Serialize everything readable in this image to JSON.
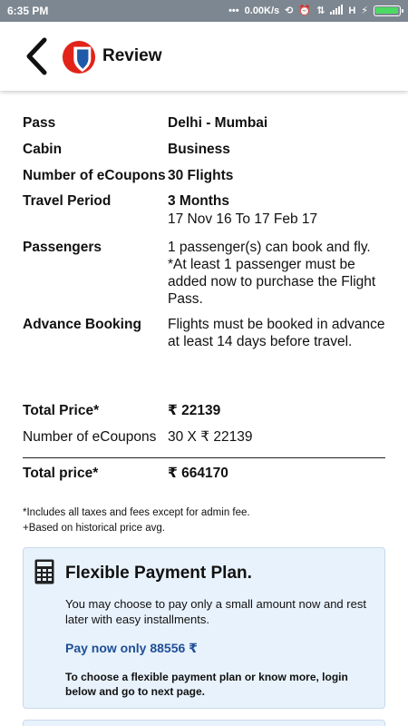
{
  "status_bar": {
    "time": "6:35 PM",
    "speed": "0.00K/s",
    "network_label": "H",
    "battery_level": 1.0,
    "battery_color": "#4cd964",
    "icons": [
      "dots-icon",
      "sync-icon",
      "alarm-icon",
      "data-arrows-icon",
      "signal-icon",
      "charging-icon"
    ]
  },
  "header": {
    "title": "Review",
    "back_icon": "chevron-left-icon",
    "logo": "airline-logo"
  },
  "details": {
    "pass_label": "Pass",
    "pass_value": "Delhi - Mumbai",
    "cabin_label": "Cabin",
    "cabin_value": "Business",
    "coupons_label": "Number of eCoupons",
    "coupons_value": "30 Flights",
    "travel_label": "Travel Period",
    "travel_value": "3 Months",
    "travel_dates": "17 Nov 16 To 17 Feb 17",
    "passengers_label": "Passengers",
    "passengers_value": "1 passenger(s) can book and fly. *At least 1 passenger must be added now to purchase the Flight Pass.",
    "advance_label": "Advance Booking",
    "advance_value": "Flights must be booked in advance at least 14 days before travel."
  },
  "pricing": {
    "total_price_label": "Total Price*",
    "total_price_value": "₹ 22139",
    "num_coupons_label": "Number of eCoupons",
    "num_coupons_value": "30 X ₹ 22139",
    "grand_total_label": "Total price*",
    "grand_total_value": "₹ 664170"
  },
  "notes": {
    "line1": "*Includes all taxes and fees except for admin fee.",
    "line2": "+Based on historical price avg."
  },
  "payment_plan": {
    "icon": "calculator-icon",
    "title": "Flexible Payment Plan.",
    "description": "You may choose to pay only a small amount now and rest later with easy installments.",
    "pay_now": "Pay now only 88556 ₹",
    "note": "To choose a flexible payment plan or know more, login below and go to next page."
  },
  "colors": {
    "status_bar": "#7d8791",
    "card_bg": "#e8f2fc",
    "pay_now": "#1f4f96",
    "logo_red": "#e2231a",
    "logo_blue": "#1f5aa8"
  }
}
